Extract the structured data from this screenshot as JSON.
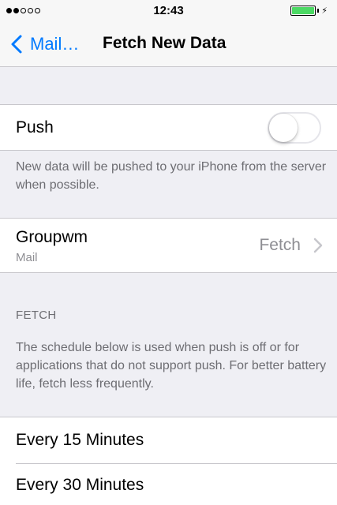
{
  "status_bar": {
    "signal_bars": 2,
    "time": "12:43",
    "battery_level": 1.0
  },
  "nav": {
    "back_label": "Mail…",
    "title": "Fetch New Data"
  },
  "push": {
    "label": "Push",
    "enabled": false,
    "footer": "New data will be pushed to your iPhone from the server when possible."
  },
  "account": {
    "name": "Groupwm",
    "type": "Mail",
    "value": "Fetch"
  },
  "fetch_section": {
    "header": "FETCH",
    "description": "The schedule below is used when push is off or for applications that do not support push. For better battery life, fetch less frequently.",
    "options": [
      "Every 15 Minutes",
      "Every 30 Minutes"
    ]
  },
  "colors": {
    "accent": "#007aff",
    "background": "#efeff4",
    "battery": "#4cd964"
  },
  "icons": {
    "back": "chevron-left-icon",
    "disclosure": "chevron-right-icon",
    "charging": "bolt-icon"
  }
}
